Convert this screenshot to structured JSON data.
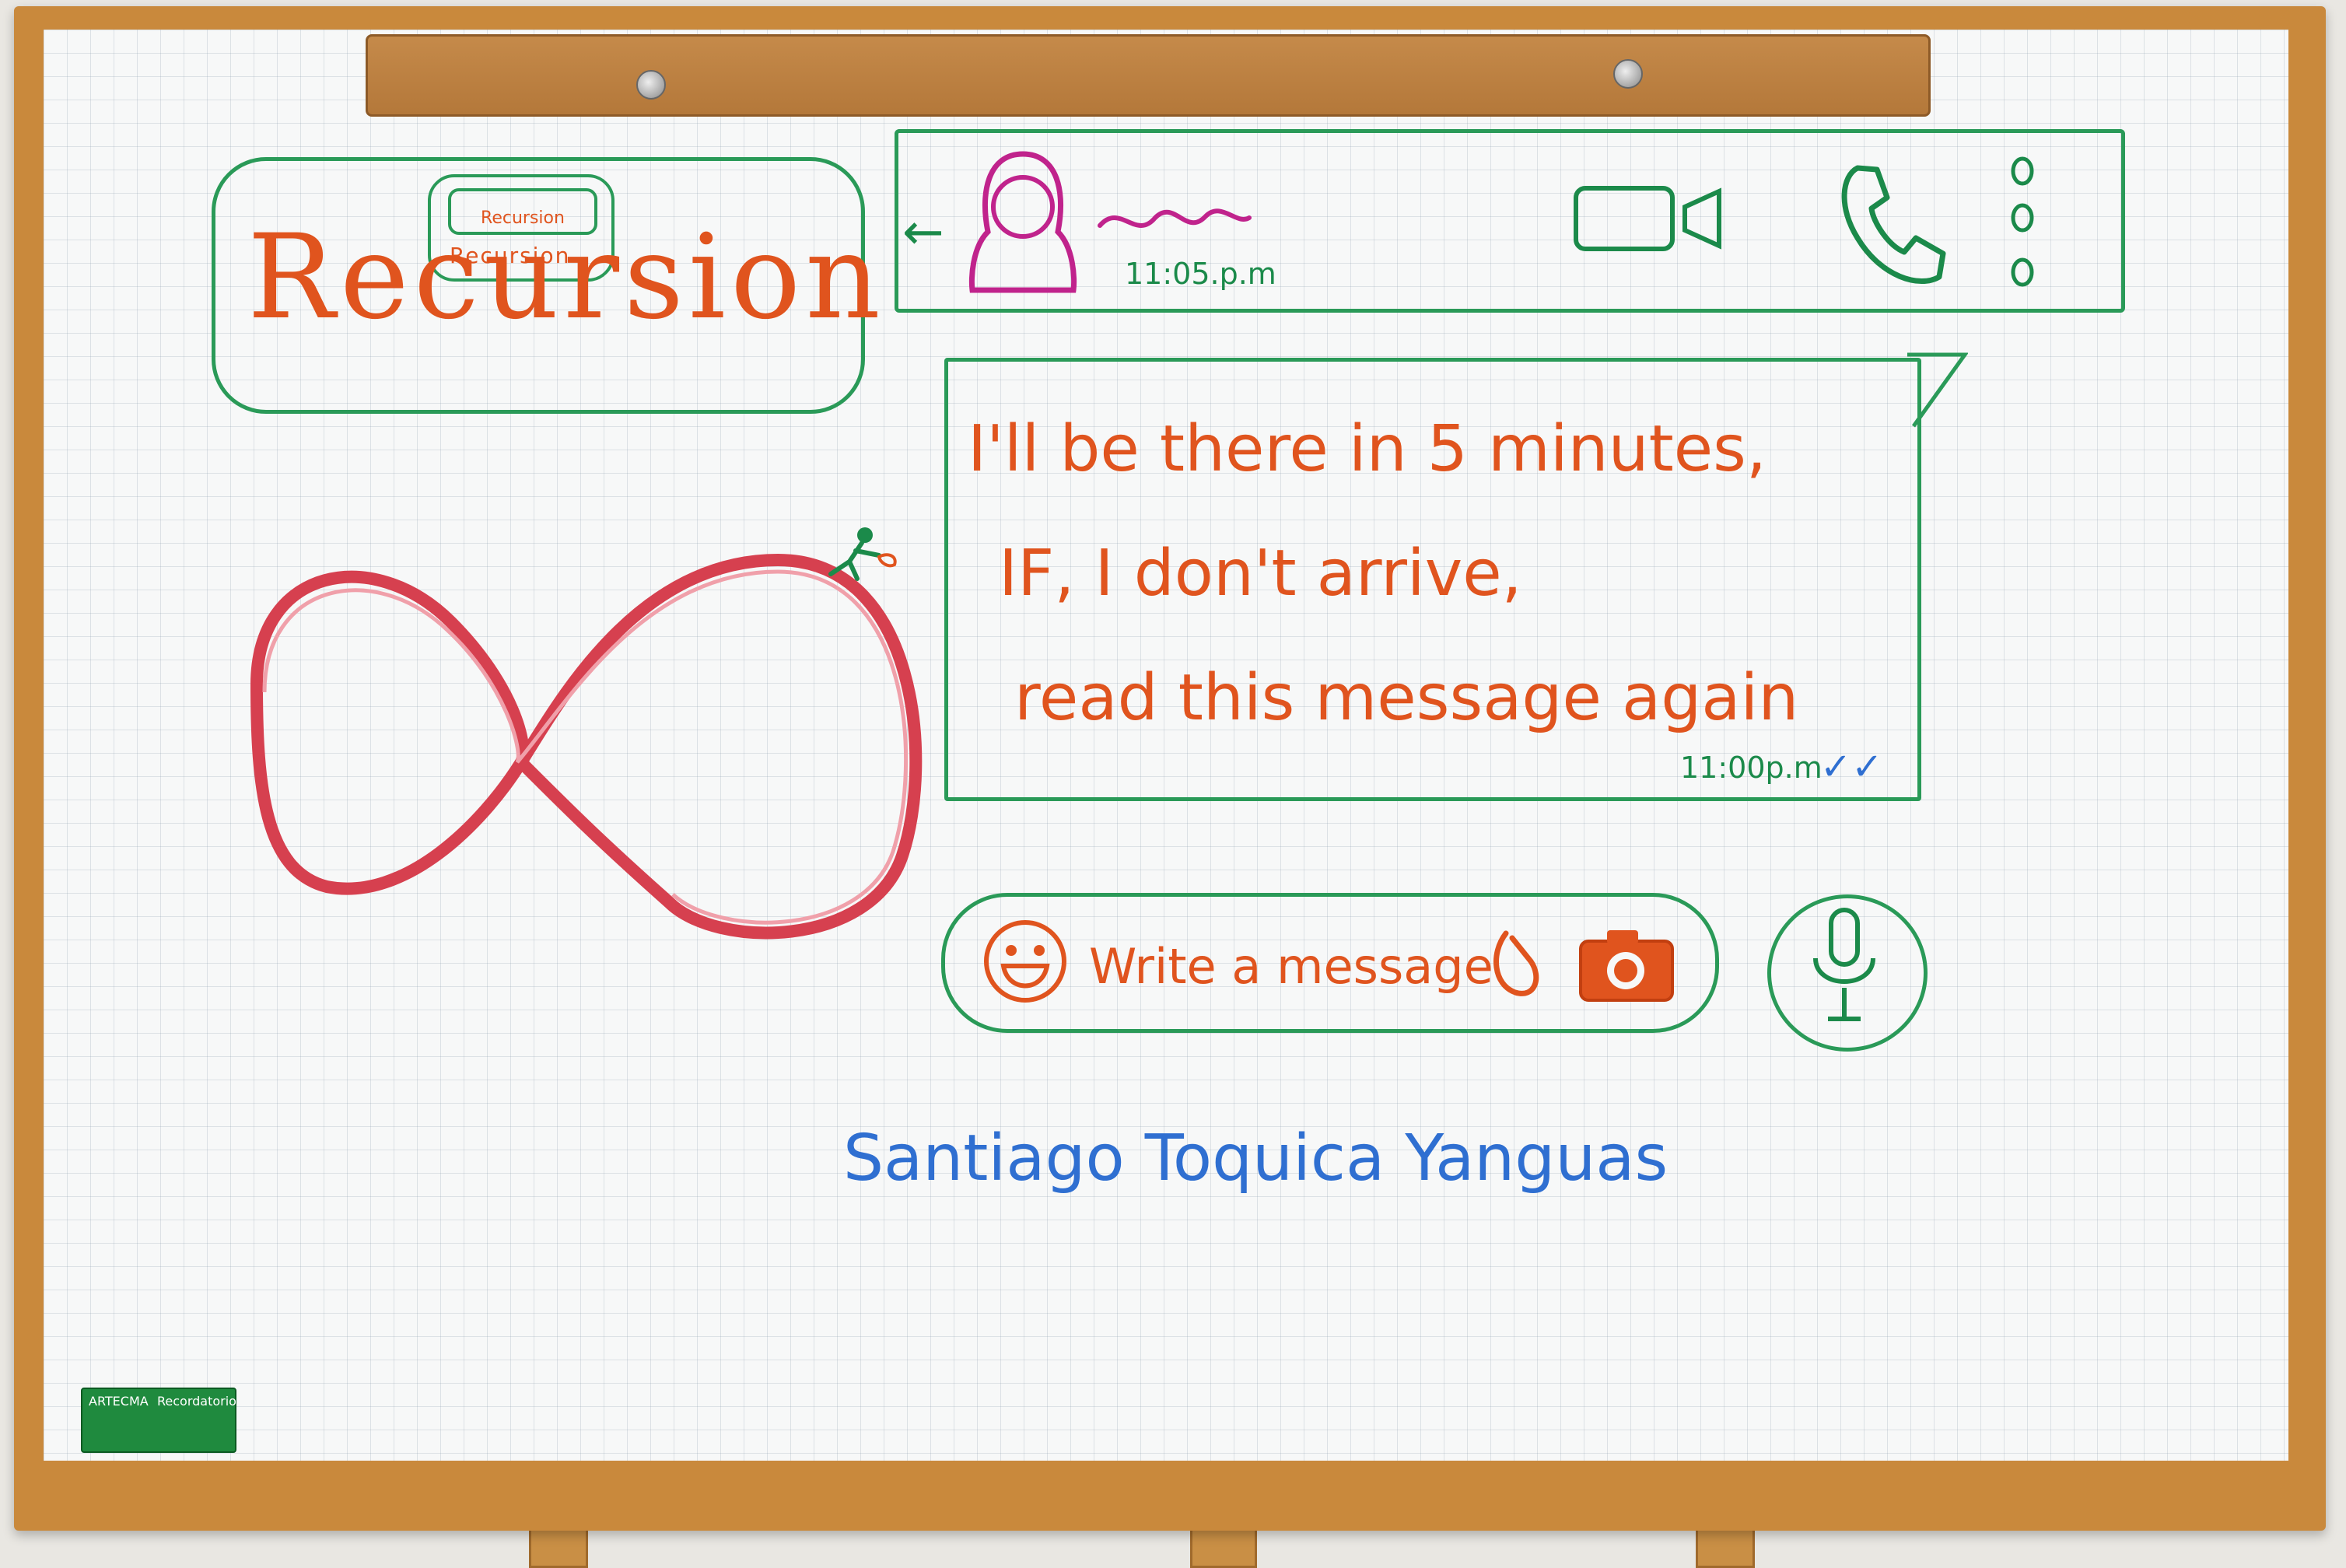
{
  "logo": {
    "word": "Recursion",
    "mini_label": "Recursion",
    "mini_inner": "Recursion"
  },
  "chat_header": {
    "time": "11:05.p.m",
    "icons": [
      "back-arrow-icon",
      "contact-avatar-icon",
      "video-call-icon",
      "phone-call-icon",
      "more-options-icon"
    ]
  },
  "message": {
    "lines": [
      "I'll be there in 5 minutes,",
      "IF, I don't arrive,",
      "read this message again"
    ],
    "time": "11:00p.m",
    "ticks": "✓✓"
  },
  "composer": {
    "placeholder": "Write a message",
    "icons": [
      "emoji-icon",
      "attach-clip-icon",
      "camera-icon",
      "microphone-icon"
    ]
  },
  "signature": "Santiago Toquica Yanguas",
  "sticker": {
    "left": "ARTECMA",
    "right": "Recordatorio"
  },
  "colors": {
    "marker_orange": "#e0541e",
    "marker_green": "#1b8a4a",
    "marker_blue": "#2f6fd1",
    "marker_red": "#d6404f",
    "marker_magenta": "#c0238c"
  }
}
